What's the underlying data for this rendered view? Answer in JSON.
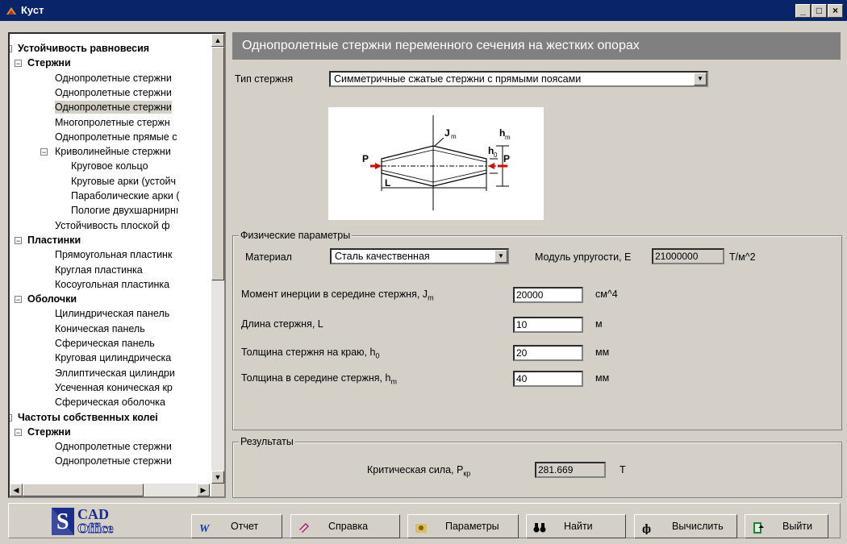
{
  "window": {
    "title": "Куст"
  },
  "tree": {
    "items": [
      {
        "label": "Устойчивость равновесия",
        "level": 0,
        "bold": true,
        "exp": "−"
      },
      {
        "label": "Стержни",
        "level": 1,
        "bold": true,
        "exp": "−"
      },
      {
        "label": "Однопролетные стержни",
        "level": 2
      },
      {
        "label": "Однопролетные стержни",
        "level": 2
      },
      {
        "label": "Однопролетные стержни",
        "level": 2,
        "selected": true
      },
      {
        "label": "Многопролетные стержн",
        "level": 2
      },
      {
        "label": "Однопролетные прямые с",
        "level": 2
      },
      {
        "label": "Криволинейные стержни",
        "level": 2,
        "exp": "−"
      },
      {
        "label": "Круговое кольцо",
        "level": 3
      },
      {
        "label": "Круговые арки (устойч",
        "level": 3
      },
      {
        "label": "Параболические арки (",
        "level": 3
      },
      {
        "label": "Пологие двухшарнирнı",
        "level": 3
      },
      {
        "label": "Устойчивость плоской ф",
        "level": 2
      },
      {
        "label": "Пластинки",
        "level": 1,
        "bold": true,
        "exp": "−"
      },
      {
        "label": "Прямоугольная пластинк",
        "level": 2
      },
      {
        "label": "Круглая пластинка",
        "level": 2
      },
      {
        "label": "Косоугольная пластинка",
        "level": 2
      },
      {
        "label": "Оболочки",
        "level": 1,
        "bold": true,
        "exp": "−"
      },
      {
        "label": "Цилиндрическая панель",
        "level": 2
      },
      {
        "label": "Коническая панель",
        "level": 2
      },
      {
        "label": "Сферическая панель",
        "level": 2
      },
      {
        "label": "Круговая цилиндрическа",
        "level": 2
      },
      {
        "label": "Эллиптическая цилиндри",
        "level": 2
      },
      {
        "label": "Усеченная коническая кр",
        "level": 2
      },
      {
        "label": "Сферическая оболочка",
        "level": 2
      },
      {
        "label": "Частоты собственных колеі",
        "level": 0,
        "bold": true,
        "exp": "−"
      },
      {
        "label": "Стержни",
        "level": 1,
        "bold": true,
        "exp": "−"
      },
      {
        "label": "Однопролетные стержни",
        "level": 2
      },
      {
        "label": "Однопролетные стержни",
        "level": 2
      }
    ]
  },
  "main": {
    "header": "Однопролетные стержни переменного сечения на жестких опорах",
    "type_label": "Тип стержня",
    "type_value": "Симметричные сжатые стержни с прямыми поясами",
    "diagram": {
      "jm": "J",
      "jm_sub": "m",
      "hm": "h",
      "hm_sub": "m",
      "h0": "h",
      "h0_sub": "0",
      "p": "P",
      "l": "L"
    },
    "physical": {
      "title": "Физические параметры",
      "material_label": "Материал",
      "material_value": "Сталь качественная",
      "modulus_label": "Модуль упругости, E",
      "modulus_value": "21000000",
      "modulus_unit": "Т/м^2",
      "params": [
        {
          "label": "Момент инерции в середине стержня, J",
          "sub": "m",
          "value": "20000",
          "unit": "см^4"
        },
        {
          "label": "Длина стержня, L",
          "sub": "",
          "value": "10",
          "unit": "м"
        },
        {
          "label": "Толщина стержня на краю, h",
          "sub": "0",
          "value": "20",
          "unit": "мм"
        },
        {
          "label": "Толщина  в середине стержня, h",
          "sub": "m",
          "value": "40",
          "unit": "мм"
        }
      ]
    },
    "results": {
      "title": "Результаты",
      "label": "Критическая сила, P",
      "sub": "кр",
      "value": "281.669",
      "unit": "Т"
    }
  },
  "toolbar": {
    "logo_top": "CAD",
    "logo_bottom": "Office",
    "buttons": [
      {
        "label": "Отчет",
        "icon": "word-icon"
      },
      {
        "label": "Справка",
        "icon": "help-book-icon"
      },
      {
        "label": "Параметры",
        "icon": "settings-icon"
      },
      {
        "label": "Найти",
        "icon": "binoculars-icon"
      },
      {
        "label": "Вычислить",
        "icon": "calculate-icon"
      },
      {
        "label": "Выйти",
        "icon": "exit-icon"
      }
    ]
  },
  "colors": {
    "titlebar": "#0a246a",
    "header": "#808080",
    "face": "#d4d0c8"
  }
}
